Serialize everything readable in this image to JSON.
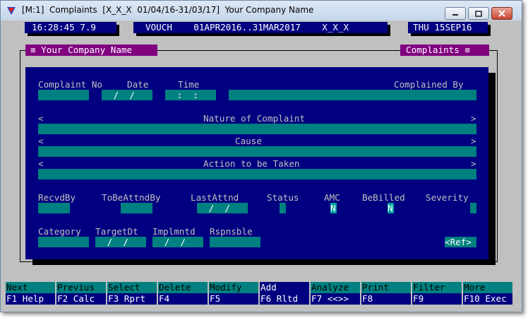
{
  "window": {
    "title": "[M:1]  Complaints  [X_X_X  01/04/16-31/03/17]  Your Company Name"
  },
  "status_bar": {
    "time": "16:28:45 7.9",
    "voucher": "VOUCH    01APR2016..31MAR2017    X_X_X",
    "date": "THU 15SEP16"
  },
  "headers": {
    "company": "≡ Your Company Name",
    "module": "Complaints ≡"
  },
  "form": {
    "labels": {
      "complaint_no": "Complaint No",
      "date": "Date",
      "time": "Time",
      "complained_by": "Complained By",
      "nature": "Nature of Complaint",
      "cause": "Cause",
      "action": "Action to be Taken",
      "recvd_by": "RecvdBy",
      "to_be_attnd_by": "ToBeAttndBy",
      "last_attnd": "LastAttnd",
      "status": "Status",
      "amc": "AMC",
      "be_billed": "BeBilled",
      "severity": "Severity",
      "category": "Category",
      "target_dt": "TargetDt",
      "implmntd": "Implmntd",
      "rspnsble": "Rspnsble"
    },
    "values": {
      "complaint_no": "",
      "date": " /  /",
      "time": " :  :",
      "complained_by": "",
      "nature": "",
      "cause": "",
      "action": "",
      "recvd_by": "",
      "to_be_attnd_by": "",
      "last_attnd": " /  /",
      "status": "",
      "amc": "N",
      "be_billed": "N",
      "severity": "",
      "category": "",
      "target_dt": " /  /",
      "implmntd": " /  /",
      "rspnsble": ""
    },
    "arrow_left": "<",
    "arrow_right": ">",
    "ref_button": "<Ref>"
  },
  "function_keys": [
    {
      "top": "Next",
      "bottom": "F1 Help"
    },
    {
      "top": "Previus",
      "bottom": "F2 Calc"
    },
    {
      "top": "Select",
      "bottom": "F3 Rprt"
    },
    {
      "top": "Delete",
      "bottom": "F4"
    },
    {
      "top": "Modify",
      "bottom": "F5"
    },
    {
      "top": "Add",
      "bottom": "F6 Rltd"
    },
    {
      "top": "Analyze",
      "bottom": "F7 <<>>"
    },
    {
      "top": "Print",
      "bottom": "F8"
    },
    {
      "top": "Filter",
      "bottom": "F9"
    },
    {
      "top": "More",
      "bottom": "F10 Exec"
    }
  ],
  "colors": {
    "navy": "#000080",
    "teal": "#008080",
    "purple": "#800080",
    "gray": "#c0c0c0"
  }
}
